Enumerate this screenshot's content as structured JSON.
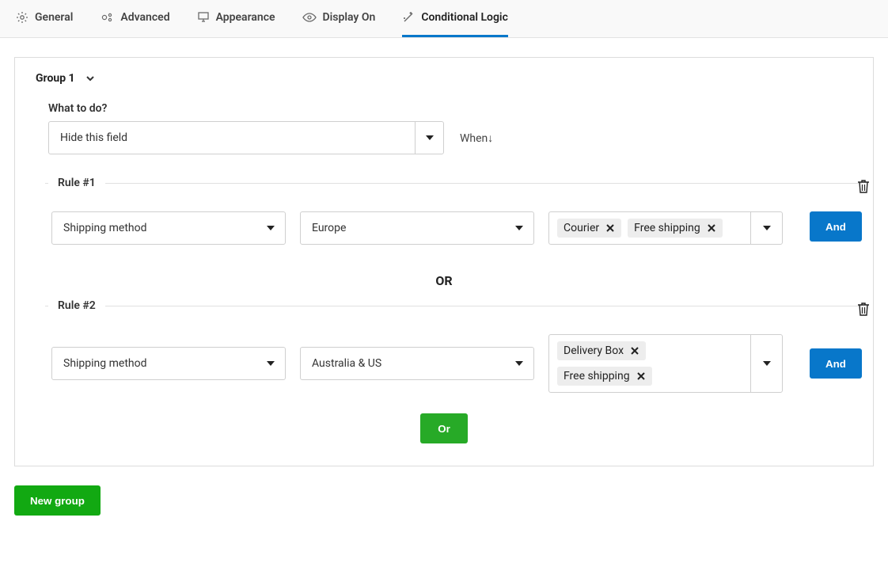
{
  "tabs": {
    "general": "General",
    "advanced": "Advanced",
    "appearance": "Appearance",
    "displayOn": "Display On",
    "conditional": "Conditional Logic"
  },
  "group": {
    "title": "Group 1",
    "whatLabel": "What to do?",
    "action": "Hide this field",
    "when": "When",
    "orSeparator": "OR",
    "rules": [
      {
        "legend": "Rule #1",
        "subject": "Shipping method",
        "region": "Europe",
        "tags": [
          "Courier",
          "Free shipping"
        ]
      },
      {
        "legend": "Rule #2",
        "subject": "Shipping method",
        "region": "Australia & US",
        "tags": [
          "Delivery Box",
          "Free shipping"
        ]
      }
    ],
    "andButton": "And",
    "orButton": "Or",
    "newGroup": "New group"
  }
}
